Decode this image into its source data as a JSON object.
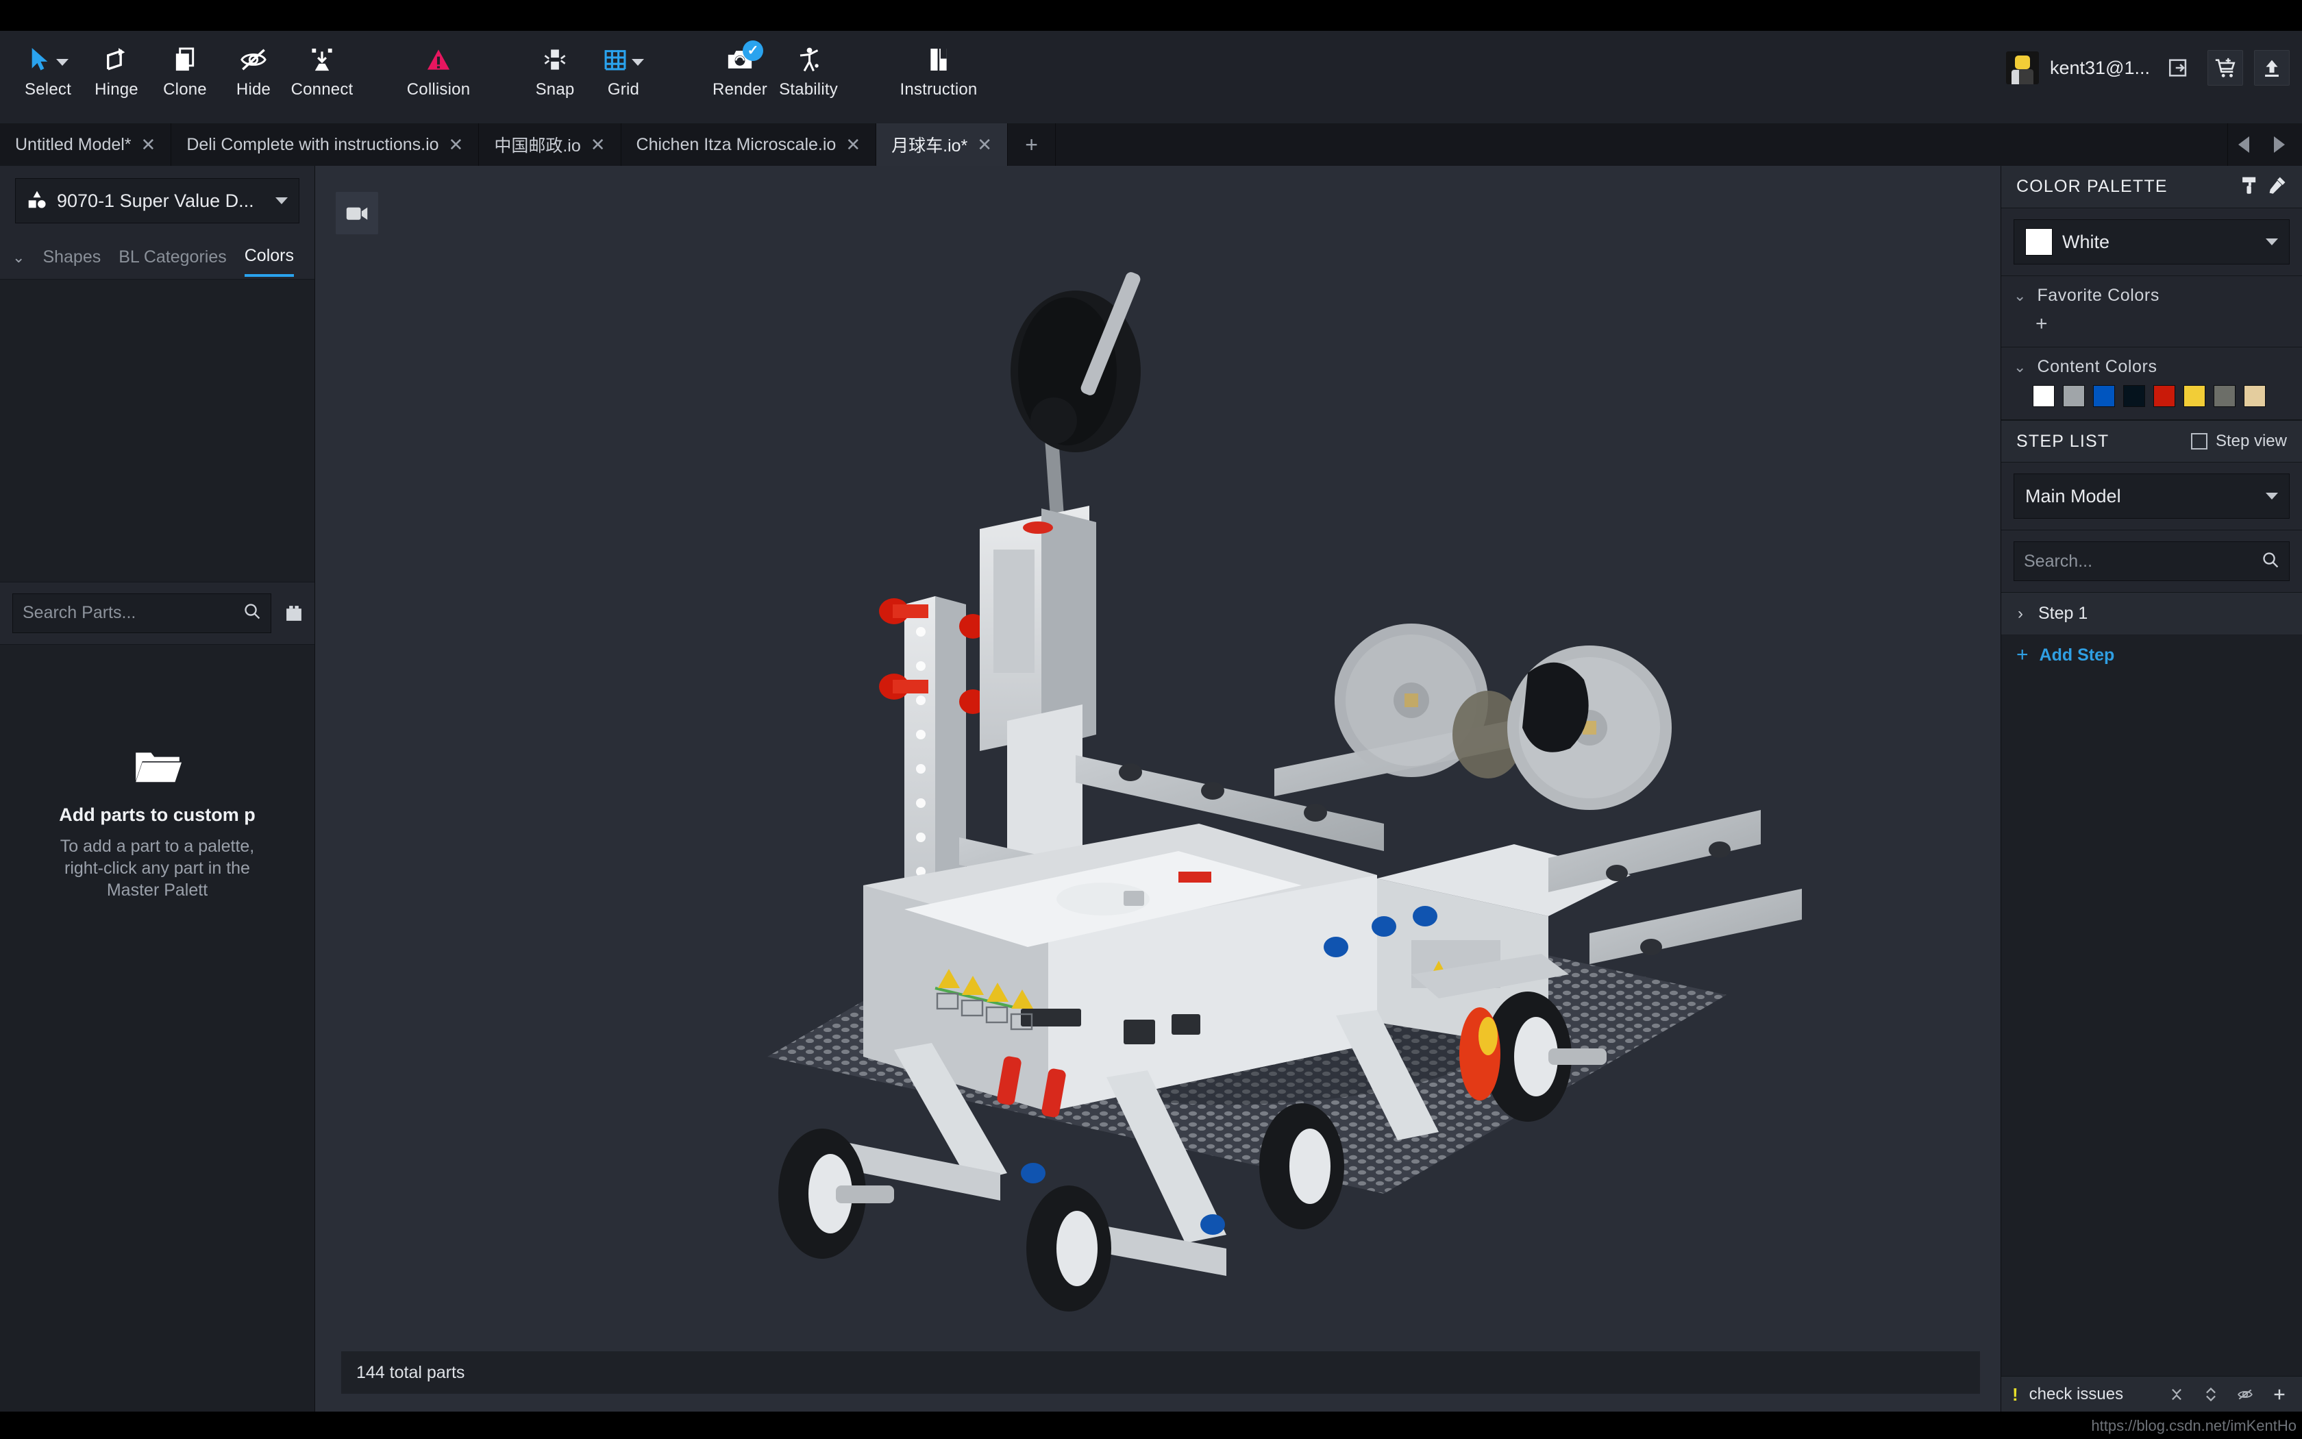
{
  "toolbar": {
    "tools": [
      {
        "label": "Select",
        "icon": "cursor-arrow-icon",
        "has_caret": true
      },
      {
        "label": "Hinge",
        "icon": "hinge-rotate-icon",
        "has_caret": false
      },
      {
        "label": "Clone",
        "icon": "clone-copy-icon",
        "has_caret": false
      },
      {
        "label": "Hide",
        "icon": "eye-slash-icon",
        "has_caret": false
      },
      {
        "label": "Connect",
        "icon": "connect-icon",
        "has_caret": false
      },
      {
        "label": "Collision",
        "icon": "collision-warning-icon",
        "has_caret": false
      },
      {
        "label": "Snap",
        "icon": "snap-magnet-icon",
        "has_caret": false
      },
      {
        "label": "Grid",
        "icon": "grid-icon",
        "has_caret": true
      },
      {
        "label": "Render",
        "icon": "camera-render-icon",
        "has_caret": false,
        "badge": "check"
      },
      {
        "label": "Stability",
        "icon": "stability-figure-icon",
        "has_caret": false
      },
      {
        "label": "Instruction",
        "icon": "instruction-book-icon",
        "has_caret": false
      }
    ],
    "collision_color": "#e8165f",
    "accent_color": "#2aa3ee"
  },
  "account": {
    "name": "kent31@1...",
    "avatar_alt": "minifig-avatar",
    "logout_icon": "logout-icon",
    "cart_icon": "cart-icon",
    "upload_icon": "upload-icon"
  },
  "tabs": {
    "items": [
      {
        "label": "Untitled Model*",
        "active": false
      },
      {
        "label": "Deli Complete with instructions.io",
        "active": false
      },
      {
        "label": "中国邮政.io",
        "active": false
      },
      {
        "label": "Chichen Itza Microscale.io",
        "active": false
      },
      {
        "label": "月球车.io*",
        "active": true
      }
    ],
    "add_label": "+",
    "prev_icon": "chevron-left-icon",
    "next_icon": "chevron-right-icon"
  },
  "left_panel": {
    "palette_select": {
      "value": "9070-1 Super Value D...",
      "icon": "shapes-icon"
    },
    "tabs": [
      {
        "label": "Shapes",
        "selected": false
      },
      {
        "label": "BL Categories",
        "selected": false
      },
      {
        "label": "Colors",
        "selected": true
      }
    ],
    "search": {
      "placeholder": "Search Parts...",
      "value": "",
      "icon": "search-icon"
    },
    "view_buttons": [
      {
        "icon": "brick-view-icon"
      },
      {
        "icon": "grid-view-icon"
      }
    ],
    "empty_state": {
      "icon": "folder-open-icon",
      "title": "Add parts to custom p",
      "description": "To add a part to a palette, right-click any part in the Master Palett"
    }
  },
  "viewport": {
    "camera_icon": "camera-icon",
    "status_text": "144 total parts",
    "background_color": "#2a2e37"
  },
  "right_panel": {
    "color_palette": {
      "title": "COLOR PALETTE",
      "header_icons": [
        {
          "icon": "paint-roller-icon"
        },
        {
          "icon": "eyedropper-icon"
        }
      ],
      "selected_color": {
        "name": "White",
        "hex": "#ffffff"
      },
      "favorite_colors": {
        "title": "Favorite Colors",
        "add_label": "+",
        "colors": []
      },
      "content_colors": {
        "title": "Content Colors",
        "colors": [
          "#ffffff",
          "#a0a5a9",
          "#0055bf",
          "#05131d",
          "#c91a09",
          "#f2cd37",
          "#6c6e68",
          "#e4cd9e"
        ]
      }
    },
    "step_list": {
      "title": "STEP LIST",
      "step_view_label": "Step view",
      "step_view_checked": false,
      "model_select": "Main Model",
      "search": {
        "placeholder": "Search...",
        "value": "",
        "icon": "search-icon"
      },
      "steps": [
        {
          "label": "Step 1",
          "expanded": false
        }
      ],
      "add_step_label": "Add Step"
    },
    "issues": {
      "label": "check issues",
      "warning_icon": "exclamation-icon",
      "buttons": [
        {
          "icon": "collapse-icon"
        },
        {
          "icon": "expand-vertical-icon"
        },
        {
          "icon": "eye-slash-icon"
        },
        {
          "icon": "plus-icon"
        }
      ]
    }
  },
  "watermark": "https://blog.csdn.net/imKentHo"
}
